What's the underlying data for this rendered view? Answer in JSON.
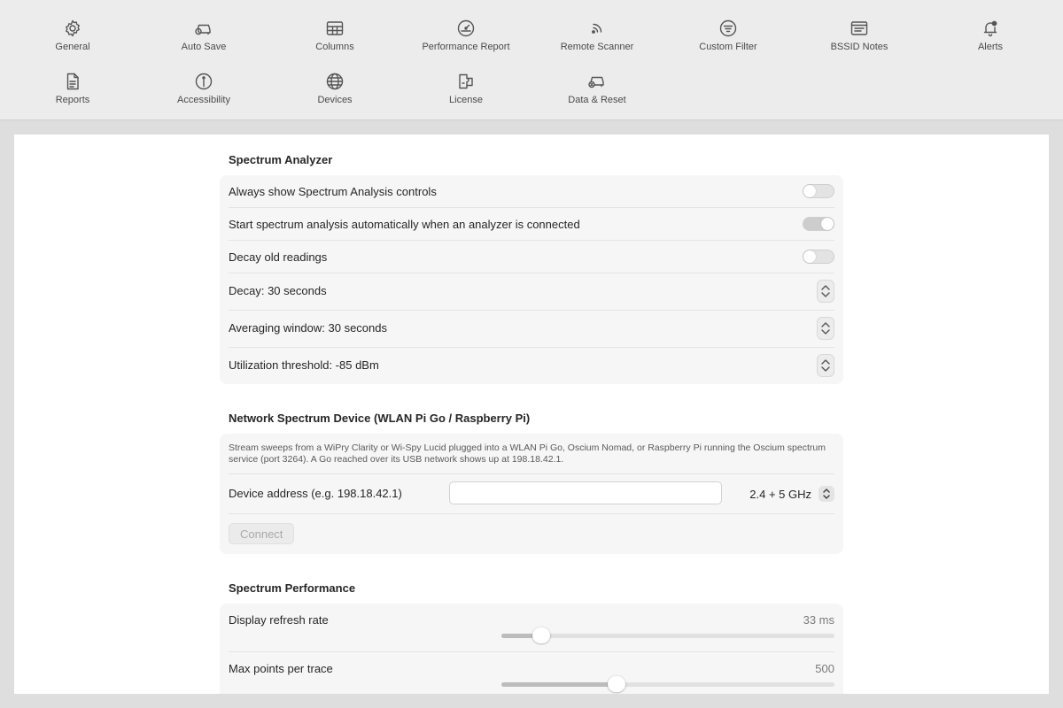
{
  "toolbar": {
    "items": [
      {
        "label": "General",
        "icon": "gear-icon"
      },
      {
        "label": "Auto Save",
        "icon": "car-clock-icon"
      },
      {
        "label": "Columns",
        "icon": "table-icon"
      },
      {
        "label": "Performance Report",
        "icon": "gauge-icon"
      },
      {
        "label": "Remote Scanner",
        "icon": "signal-icon"
      },
      {
        "label": "Custom Filter",
        "icon": "filter-icon"
      },
      {
        "label": "BSSID Notes",
        "icon": "notes-window-icon"
      },
      {
        "label": "Alerts",
        "icon": "bell-badge-icon"
      },
      {
        "label": "Reports",
        "icon": "document-icon"
      },
      {
        "label": "Accessibility",
        "icon": "accessibility-icon"
      },
      {
        "label": "Devices",
        "icon": "globe-icon"
      },
      {
        "label": "License",
        "icon": "license-icon"
      },
      {
        "label": "Data & Reset",
        "icon": "car-reset-icon"
      }
    ]
  },
  "spectrum_analyzer": {
    "title": "Spectrum Analyzer",
    "always_show": {
      "label": "Always show Spectrum Analysis controls",
      "on": false
    },
    "auto_start": {
      "label": "Start spectrum analysis automatically when an analyzer is connected",
      "on": true
    },
    "decay_old": {
      "label": "Decay old readings",
      "on": false
    },
    "decay": {
      "label": "Decay: 30 seconds"
    },
    "averaging": {
      "label": "Averaging window: 30 seconds"
    },
    "threshold": {
      "label": "Utilization threshold: -85 dBm"
    }
  },
  "network_device": {
    "title": "Network Spectrum Device (WLAN Pi Go / Raspberry Pi)",
    "description": "Stream sweeps from a WiPry Clarity or Wi-Spy Lucid plugged into a WLAN Pi Go, Oscium Nomad, or Raspberry Pi running the Oscium spectrum service (port 3264). A Go reached over its USB network shows up at 198.18.42.1.",
    "address_label": "Device address (e.g. 198.18.42.1)",
    "address_value": "",
    "band_value": "2.4 + 5 GHz",
    "connect_label": "Connect"
  },
  "performance": {
    "title": "Spectrum Performance",
    "refresh": {
      "label": "Display refresh rate",
      "value_text": "33 ms",
      "fraction": 0.12
    },
    "max_points": {
      "label": "Max points per trace",
      "value_text": "500",
      "fraction": 0.345
    }
  },
  "colors": {
    "toolbar_bg": "#ececec",
    "window_bg": "#dedede",
    "group_bg": "#f6f6f6",
    "text": "#262626"
  }
}
